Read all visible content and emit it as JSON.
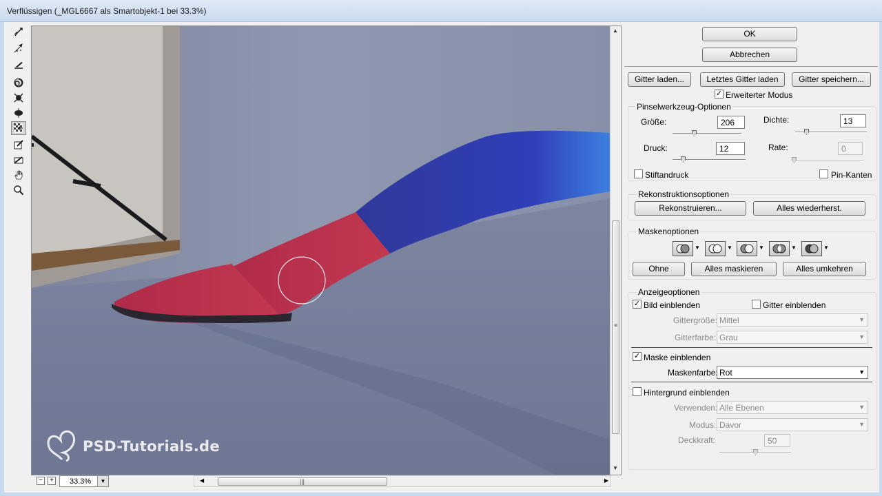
{
  "window": {
    "title": "Verflüssigen (_MGL6667 als Smartobjekt-1 bei 33.3%)"
  },
  "tools": [
    {
      "icon": "forward-warp-icon"
    },
    {
      "icon": "reconstruct-icon"
    },
    {
      "icon": "smooth-icon"
    },
    {
      "icon": "twirl-clockwise-icon"
    },
    {
      "icon": "pucker-icon"
    },
    {
      "icon": "bloat-icon"
    },
    {
      "icon": "push-left-icon",
      "active": true
    },
    {
      "icon": "freeze-mask-icon"
    },
    {
      "icon": "thaw-mask-icon"
    },
    {
      "icon": "hand-icon"
    },
    {
      "icon": "zoom-icon"
    }
  ],
  "canvas": {
    "watermark": "PSD-Tutorials.de"
  },
  "bottom": {
    "zoom_out": "−",
    "zoom_in": "+",
    "zoom_value": "33.3%"
  },
  "buttons": {
    "ok": "OK",
    "cancel": "Abbrechen",
    "load_mesh": "Gitter laden...",
    "load_last_mesh": "Letztes Gitter laden",
    "save_mesh": "Gitter speichern..."
  },
  "advanced_mode": {
    "label": "Erweiterter Modus",
    "checked": true
  },
  "brush": {
    "title": "Pinselwerkzeug-Optionen",
    "size_label": "Größe:",
    "size_value": "206",
    "size_fraction": 0.3,
    "density_label": "Dichte:",
    "density_value": "13",
    "density_fraction": 0.13,
    "pressure_label": "Druck:",
    "pressure_value": "12",
    "pressure_fraction": 0.12,
    "rate_label": "Rate:",
    "rate_value": "0",
    "rate_fraction": 0.0,
    "stylus_label": "Stiftandruck",
    "pin_edges_label": "Pin-Kanten"
  },
  "reconstruct": {
    "title": "Rekonstruktionsoptionen",
    "reconstruct_btn": "Rekonstruieren...",
    "restore_all_btn": "Alles wiederherst."
  },
  "mask": {
    "title": "Maskenoptionen",
    "none_btn": "Ohne",
    "mask_all_btn": "Alles maskieren",
    "invert_all_btn": "Alles umkehren",
    "icons": [
      "replace-selection-icon",
      "add-to-selection-icon",
      "subtract-from-selection-icon",
      "intersect-selection-icon",
      "invert-selection-icon"
    ]
  },
  "view": {
    "title": "Anzeigeoptionen",
    "show_image": "Bild einblenden",
    "show_mesh": "Gitter einblenden",
    "mesh_size_label": "Gittergröße:",
    "mesh_size_value": "Mittel",
    "mesh_color_label": "Gitterfarbe:",
    "mesh_color_value": "Grau",
    "show_mask": "Maske einblenden",
    "mask_color_label": "Maskenfarbe:",
    "mask_color_value": "Rot",
    "show_backdrop": "Hintergrund einblenden",
    "use_label": "Verwenden:",
    "use_value": "Alle Ebenen",
    "mode_label": "Modus:",
    "mode_value": "Davor",
    "opacity_label": "Deckkraft:",
    "opacity_value": "50",
    "opacity_fraction": 0.5
  },
  "check": "✓"
}
